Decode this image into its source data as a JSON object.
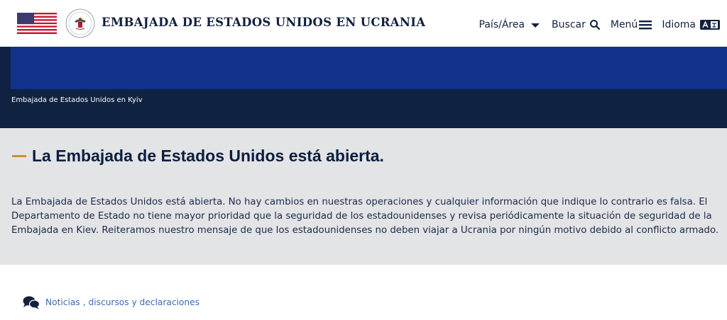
{
  "header": {
    "site_title": "EMBAJADA DE ESTADOS UNIDOS EN UCRANIA",
    "nav": {
      "country": "País/Área",
      "search": "Buscar",
      "menu": "Menú",
      "language": "Idioma"
    }
  },
  "hero": {
    "caption": "Embajada de Estados Unidos en Kyiv"
  },
  "alert": {
    "title": "La Embajada de Estados Unidos está abierta.",
    "body": "La Embajada de Estados Unidos está abierta.   No hay cambios en nuestras operaciones y cualquier información que indique lo contrario es falsa. El Departamento de Estado no tiene mayor prioridad que la seguridad de los estadounidenses y revisa periódicamente la situación de seguridad de la Embajada en Kiev.   Reiteramos nuestro mensaje de que los estadounidenses no deben viajar a Ucrania por ningún motivo debido al conflicto armado."
  },
  "news": {
    "link1": "Noticias",
    "separator": ",",
    "link2": "discursos y declaraciones"
  },
  "colors": {
    "navy": "#0f2241",
    "blue": "#12318a",
    "gold": "#c6922c",
    "link": "#3b6bb1",
    "alert_bg": "#e3e4e6"
  },
  "icons": [
    "us-flag-icon",
    "state-seal-icon",
    "caret-down-icon",
    "search-icon",
    "menu-icon",
    "language-icon",
    "speech-bubbles-icon"
  ]
}
